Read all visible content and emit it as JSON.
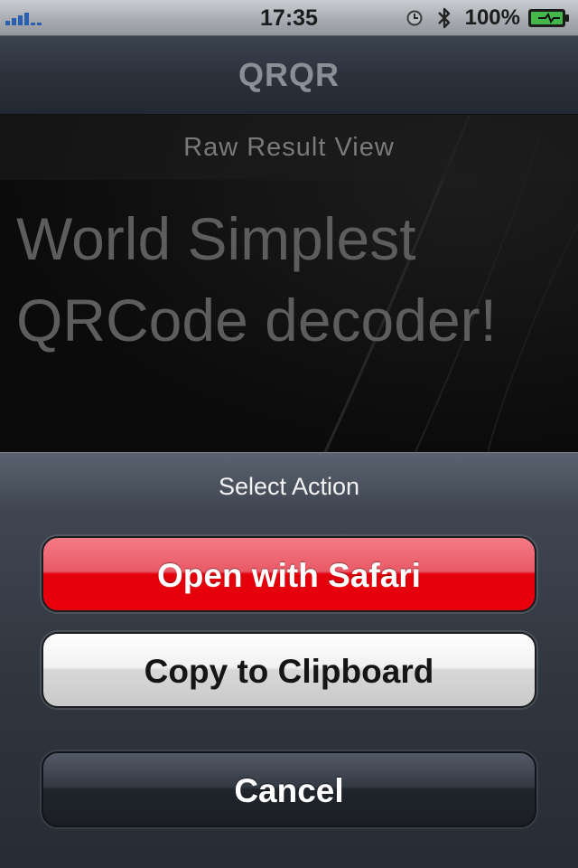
{
  "status_bar": {
    "time": "17:35",
    "battery_percent": "100%",
    "icons": [
      "signal-strength-icon",
      "clock-icon",
      "bluetooth-icon",
      "battery-charging-icon"
    ]
  },
  "nav_bar": {
    "title": "QRQR"
  },
  "content": {
    "header": "Raw Result View",
    "result_text": "World Simplest QRCode decoder!"
  },
  "action_sheet": {
    "title": "Select Action",
    "buttons": {
      "open_safari": "Open with Safari",
      "copy_clipboard": "Copy to Clipboard",
      "cancel": "Cancel"
    }
  },
  "colors": {
    "destructive_button": "#e3000a",
    "default_button": "#d8d8d8",
    "cancel_button": "#20252c",
    "nav_bar": "#2c323c"
  }
}
